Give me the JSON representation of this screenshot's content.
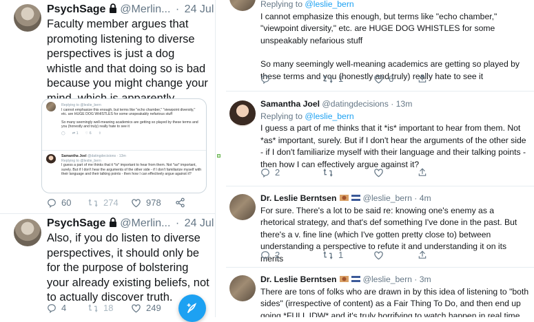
{
  "left": {
    "tweet1": {
      "author": "PsychSage",
      "handle": "@Merlin...",
      "dot": "·",
      "date": "24 Jul",
      "text": "Faculty member argues that promoting listening to diverse perspectives is just a dog whistle and that doing so is bad because you might change your mind, which is apparently horrifying.",
      "quoted": {
        "reply1": {
          "replying": "Replying to @leslie_bern",
          "text": "I cannot emphasize this enough, but terms like \"echo chamber,\" \"viewpoint diversity,\" etc. are HUGE DOG WHISTLES for some unspeakably nefarious stuff",
          "text2": "So many seemingly well-meaning academics are getting so played by these terms and you (honestly and truly) really hate to see it",
          "rts": "1",
          "likes": "6"
        },
        "reply2": {
          "name": "Samantha Joel",
          "handle": "@datingdecisions · 13m",
          "replying": "Replying to @leslie_bern",
          "text": "I guess a part of me thinks that it *is* important to hear from them. Not *as* important, surely. But if I don't hear the arguments of the other side - if I don't familiarize myself with their language and their talking points - then how I can effectively argue against it?"
        }
      },
      "replies": "60",
      "retweets": "274",
      "likes": "978"
    },
    "tweet2": {
      "author": "PsychSage",
      "handle": "@Merlin...",
      "dot": "·",
      "date": "24 Jul",
      "text": "Also, if you do listen to diverse perspectives, it should only be for the purpose of bolstering your already existing beliefs, not to actually discover truth.",
      "replies": "4",
      "retweets": "18",
      "likes": "249"
    }
  },
  "right": {
    "top": {
      "replying_prefix": "Replying to ",
      "replying_handle": "@leslie_bern",
      "text1": "I cannot emphasize this enough, but terms like \"echo chamber,\" \"viewpoint diversity,\" etc. are HUGE DOG WHISTLES for some unspeakably nefarious stuff",
      "text2": "So many seemingly well-meaning academics are getting so played by these terms and you (honestly and truly) really hate to see it",
      "rts": "1",
      "likes": "6"
    },
    "samantha": {
      "name": "Samantha Joel",
      "handle": "@datingdecisions · 13m",
      "replying_prefix": "Replying to ",
      "replying_handle": "@leslie_bern",
      "text": "I guess a part of me thinks that it *is* important to hear from them. Not *as* important, surely. But if I don't hear the arguments of the other side - if I don't familiarize myself with their language and their talking points - then how I can effectively argue against it?",
      "replies": "2"
    },
    "leslie1": {
      "name": "Dr. Leslie Berntsen",
      "handle": "@leslie_bern · 4m",
      "text": "For sure. There's a lot to be said re: knowing one's enemy as a rhetorical strategy, and that's def something I've done in the past. But there's a v. fine line (which I've gotten pretty close to) between understanding a perspective to refute it and understanding it on its merits",
      "replies": "2",
      "rts": "1"
    },
    "leslie2": {
      "name": "Dr. Leslie Berntsen",
      "handle": "@leslie_bern · 3m",
      "text": "There are tons of folks who are drawn in by this idea of listening to \"both sides\" (irrespective of content) as a Fair Thing To Do, and then end up going *FULL IDW* and it's truly horrifying to watch happen in real time"
    }
  },
  "colors": {
    "accent": "#1da1f2",
    "muted": "#657786",
    "border": "#e6ecf0"
  }
}
